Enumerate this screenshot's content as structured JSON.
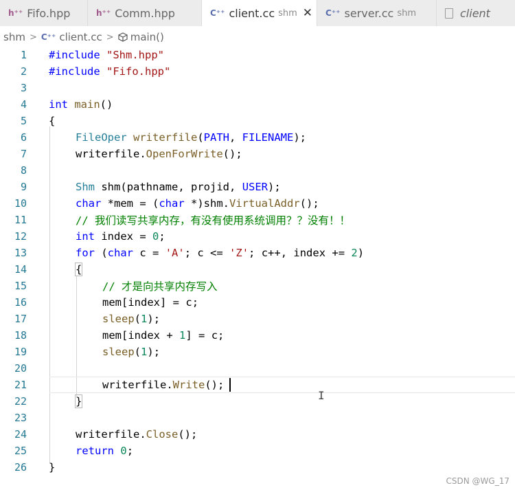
{
  "tabs": [
    {
      "label": "Fifo.hpp",
      "icon": "h-icon",
      "active": false
    },
    {
      "label": "Comm.hpp",
      "icon": "h-icon",
      "active": false
    },
    {
      "label": "client.cc",
      "desc": "shm",
      "icon": "cpp-icon",
      "active": true
    },
    {
      "label": "server.cc",
      "desc": "shm",
      "icon": "cpp-icon",
      "active": false
    },
    {
      "label": "client",
      "icon": "file-icon",
      "active": false
    }
  ],
  "tab_close_glyph": "✕",
  "breadcrumb": {
    "folder": "shm",
    "file": "client.cc",
    "symbol": "main()"
  },
  "icons": {
    "h": "h-icon",
    "cpp": "cpp-icon",
    "file": "file-icon",
    "symbol": "cube-icon",
    "close": "close-icon"
  },
  "line_numbers": [
    "1",
    "2",
    "3",
    "4",
    "5",
    "6",
    "7",
    "8",
    "9",
    "10",
    "11",
    "12",
    "13",
    "14",
    "15",
    "16",
    "17",
    "18",
    "19",
    "20",
    "21",
    "22",
    "23",
    "24",
    "25",
    "26"
  ],
  "code_tokens": {
    "l1": [
      "#include",
      " ",
      "\"Shm.hpp\""
    ],
    "l2": [
      "#include",
      " ",
      "\"Fifo.hpp\""
    ],
    "l4": [
      "int",
      " ",
      "main",
      "()"
    ],
    "l5": [
      "{"
    ],
    "l6": [
      "FileOper",
      " ",
      "writerfile",
      "(",
      "PATH",
      ", ",
      "FILENAME",
      ");"
    ],
    "l7": [
      "writerfile",
      ".",
      "OpenForWrite",
      "();"
    ],
    "l9": [
      "Shm",
      " ",
      "shm",
      "(",
      "pathname",
      ", ",
      "projid",
      ", ",
      "USER",
      ");"
    ],
    "l10": [
      "char",
      " *",
      "mem",
      " = (",
      "char",
      " *)",
      "shm",
      ".",
      "VirtualAddr",
      "();"
    ],
    "l11": [
      "// 我们读写共享内存，有没有使用系统调用？？没有！！"
    ],
    "l12": [
      "int",
      " ",
      "index",
      " = ",
      "0",
      ";"
    ],
    "l13": [
      "for",
      " (",
      "char",
      " ",
      "c",
      " = ",
      "'A'",
      "; ",
      "c",
      " <= ",
      "'Z'",
      "; ",
      "c",
      "++, ",
      "index",
      " += ",
      "2",
      ")"
    ],
    "l14": [
      "{"
    ],
    "l15": [
      "// 才是向共享内存写入"
    ],
    "l16": [
      "mem",
      "[",
      "index",
      "] = ",
      "c",
      ";"
    ],
    "l17": [
      "sleep",
      "(",
      "1",
      ");"
    ],
    "l18": [
      "mem",
      "[",
      "index",
      " + ",
      "1",
      "] = ",
      "c",
      ";"
    ],
    "l19": [
      "sleep",
      "(",
      "1",
      ");"
    ],
    "l21": [
      "writerfile",
      ".",
      "Write",
      "();"
    ],
    "l22": [
      "}"
    ],
    "l24": [
      "writerfile",
      ".",
      "Close",
      "();"
    ],
    "l25": [
      "return",
      " ",
      "0",
      ";"
    ],
    "l26": [
      "}"
    ]
  },
  "watermark": "CSDN @WG_17"
}
